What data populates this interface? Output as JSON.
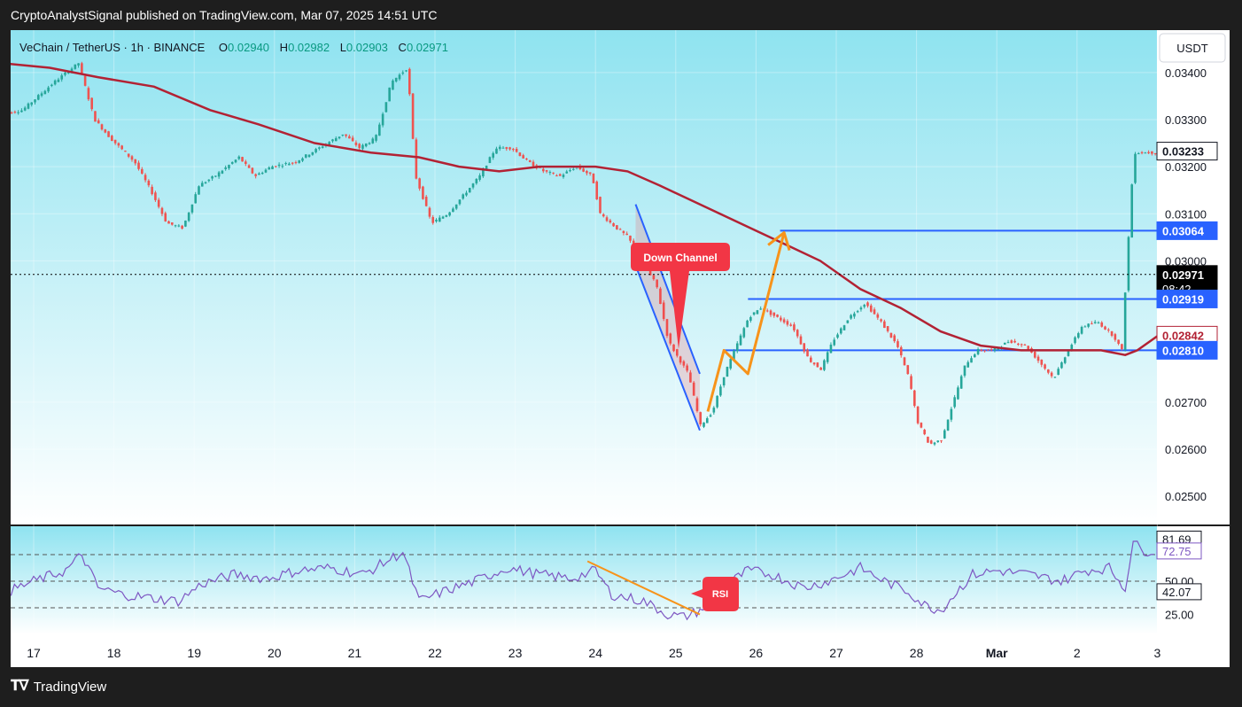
{
  "header": {
    "published": "CryptoAnalystSignal published on TradingView.com, Mar 07, 2025 14:51 UTC"
  },
  "footer": {
    "brand": "TradingView"
  },
  "legend": {
    "symbol": "VeChain / TetherUS · 1h · BINANCE",
    "o_label": "O",
    "o_value": "0.02940",
    "h_label": "H",
    "h_value": "0.02982",
    "l_label": "L",
    "l_value": "0.02903",
    "c_label": "C",
    "c_value": "0.02971"
  },
  "currency_button": "USDT",
  "annotations": {
    "down_channel": "Down Channel",
    "rsi": "RSI"
  },
  "colors": {
    "up": "#26a69a",
    "down": "#ef5350",
    "ma": "#b22234",
    "level": "#2962ff",
    "rsi_line": "#7e57c2",
    "arrow": "#f7931a",
    "bg_top": "#8fe3f0"
  },
  "chart_data": {
    "type": "candlestick",
    "x_tick_labels": [
      "17",
      "18",
      "19",
      "20",
      "21",
      "22",
      "23",
      "24",
      "25",
      "26",
      "27",
      "28",
      "Mar",
      "2",
      "3"
    ],
    "price_axis": {
      "ticks": [
        "0.03400",
        "0.03300",
        "0.03200",
        "0.03100",
        "0.03000",
        "0.02700",
        "0.02600",
        "0.02500"
      ],
      "ylim": [
        0.0244,
        0.0349
      ]
    },
    "price_tags": [
      {
        "value": "0.03233",
        "style": "outline"
      },
      {
        "value": "0.03064",
        "style": "blue"
      },
      {
        "value": "0.02971",
        "style": "black",
        "countdown": "08:42"
      },
      {
        "value": "0.02919",
        "style": "blue"
      },
      {
        "value": "0.02842",
        "style": "red-outline"
      },
      {
        "value": "0.02810",
        "style": "blue"
      }
    ],
    "horizontal_levels": [
      {
        "price": 0.03064,
        "from_day": 26.3
      },
      {
        "price": 0.02919,
        "from_day": 25.9
      },
      {
        "price": 0.0281,
        "from_day": 25.6
      }
    ],
    "current_price": 0.02971,
    "price_path": [
      [
        16.6,
        0.0331
      ],
      [
        16.9,
        0.0332
      ],
      [
        17.3,
        0.0338
      ],
      [
        17.6,
        0.0342
      ],
      [
        17.8,
        0.033
      ],
      [
        18.0,
        0.0326
      ],
      [
        18.3,
        0.0321
      ],
      [
        18.5,
        0.0315
      ],
      [
        18.7,
        0.0308
      ],
      [
        18.9,
        0.0307
      ],
      [
        19.1,
        0.0316
      ],
      [
        19.3,
        0.0318
      ],
      [
        19.6,
        0.0322
      ],
      [
        19.8,
        0.0318
      ],
      [
        20.0,
        0.032
      ],
      [
        20.3,
        0.0321
      ],
      [
        20.6,
        0.0324
      ],
      [
        20.9,
        0.0327
      ],
      [
        21.1,
        0.0324
      ],
      [
        21.3,
        0.0326
      ],
      [
        21.5,
        0.0338
      ],
      [
        21.7,
        0.0341
      ],
      [
        21.8,
        0.0318
      ],
      [
        22.0,
        0.0308
      ],
      [
        22.2,
        0.031
      ],
      [
        22.4,
        0.0314
      ],
      [
        22.6,
        0.0318
      ],
      [
        22.8,
        0.0324
      ],
      [
        23.0,
        0.0324
      ],
      [
        23.2,
        0.0321
      ],
      [
        23.4,
        0.0319
      ],
      [
        23.6,
        0.0318
      ],
      [
        23.8,
        0.032
      ],
      [
        24.0,
        0.0318
      ],
      [
        24.1,
        0.031
      ],
      [
        24.3,
        0.0307
      ],
      [
        24.45,
        0.0305
      ],
      [
        24.6,
        0.03
      ],
      [
        24.8,
        0.0295
      ],
      [
        24.95,
        0.0283
      ],
      [
        25.05,
        0.028
      ],
      [
        25.2,
        0.0276
      ],
      [
        25.35,
        0.0265
      ],
      [
        25.5,
        0.0268
      ],
      [
        25.65,
        0.0276
      ],
      [
        25.8,
        0.0282
      ],
      [
        25.95,
        0.0288
      ],
      [
        26.1,
        0.029
      ],
      [
        26.3,
        0.0288
      ],
      [
        26.5,
        0.0286
      ],
      [
        26.7,
        0.0279
      ],
      [
        26.85,
        0.0277
      ],
      [
        27.0,
        0.0283
      ],
      [
        27.2,
        0.0288
      ],
      [
        27.4,
        0.0291
      ],
      [
        27.6,
        0.0287
      ],
      [
        27.8,
        0.0282
      ],
      [
        27.95,
        0.0275
      ],
      [
        28.05,
        0.0266
      ],
      [
        28.2,
        0.0261
      ],
      [
        28.35,
        0.0262
      ],
      [
        28.5,
        0.027
      ],
      [
        28.65,
        0.0278
      ],
      [
        28.8,
        0.0281
      ],
      [
        29.0,
        0.0281
      ],
      [
        29.2,
        0.0283
      ],
      [
        29.4,
        0.0282
      ],
      [
        29.6,
        0.0278
      ],
      [
        29.75,
        0.0275
      ],
      [
        29.9,
        0.028
      ],
      [
        30.1,
        0.0286
      ],
      [
        30.3,
        0.0287
      ],
      [
        30.5,
        0.0284
      ],
      [
        30.6,
        0.0281
      ],
      [
        30.65,
        0.0296
      ],
      [
        30.75,
        0.0323
      ],
      [
        30.9,
        0.0323
      ],
      [
        31.0,
        0.0323
      ]
    ],
    "ma_path": [
      [
        16.6,
        0.0342
      ],
      [
        17.2,
        0.0341
      ],
      [
        17.8,
        0.0339
      ],
      [
        18.5,
        0.0337
      ],
      [
        19.2,
        0.0332
      ],
      [
        19.8,
        0.0329
      ],
      [
        20.5,
        0.0325
      ],
      [
        21.2,
        0.0323
      ],
      [
        21.8,
        0.0322
      ],
      [
        22.3,
        0.032
      ],
      [
        22.8,
        0.0319
      ],
      [
        23.3,
        0.032
      ],
      [
        23.8,
        0.032
      ],
      [
        24.0,
        0.032
      ],
      [
        24.4,
        0.0319
      ],
      [
        24.8,
        0.0316
      ],
      [
        25.3,
        0.0312
      ],
      [
        25.8,
        0.0308
      ],
      [
        26.3,
        0.0304
      ],
      [
        26.8,
        0.03
      ],
      [
        27.3,
        0.0294
      ],
      [
        27.8,
        0.029
      ],
      [
        28.3,
        0.0285
      ],
      [
        28.8,
        0.0282
      ],
      [
        29.3,
        0.0281
      ],
      [
        29.8,
        0.0281
      ],
      [
        30.3,
        0.0281
      ],
      [
        30.6,
        0.028
      ],
      [
        30.75,
        0.0281
      ],
      [
        31.0,
        0.0284
      ]
    ],
    "rsi": {
      "ticks": [
        "50.00",
        "25.00"
      ],
      "tags": [
        {
          "value": "81.69",
          "style": "outline"
        },
        {
          "value": "72.75",
          "style": "purple-outline"
        },
        {
          "value": "42.07",
          "style": "outline"
        }
      ],
      "levels": [
        70,
        50,
        30
      ],
      "ylim": [
        10,
        90
      ],
      "path": [
        [
          16.6,
          40
        ],
        [
          17.0,
          50
        ],
        [
          17.4,
          58
        ],
        [
          17.6,
          70
        ],
        [
          17.8,
          45
        ],
        [
          18.1,
          40
        ],
        [
          18.5,
          37
        ],
        [
          18.8,
          35
        ],
        [
          19.1,
          48
        ],
        [
          19.5,
          55
        ],
        [
          19.9,
          52
        ],
        [
          20.3,
          58
        ],
        [
          20.7,
          60
        ],
        [
          21.1,
          55
        ],
        [
          21.4,
          65
        ],
        [
          21.6,
          72
        ],
        [
          21.8,
          35
        ],
        [
          22.1,
          42
        ],
        [
          22.5,
          50
        ],
        [
          22.9,
          60
        ],
        [
          23.3,
          55
        ],
        [
          23.7,
          52
        ],
        [
          24.0,
          58
        ],
        [
          24.2,
          40
        ],
        [
          24.6,
          35
        ],
        [
          24.9,
          25
        ],
        [
          25.1,
          23
        ],
        [
          25.3,
          28
        ],
        [
          25.5,
          38
        ],
        [
          25.7,
          50
        ],
        [
          25.9,
          58
        ],
        [
          26.2,
          55
        ],
        [
          26.6,
          45
        ],
        [
          26.9,
          50
        ],
        [
          27.3,
          60
        ],
        [
          27.6,
          50
        ],
        [
          27.9,
          42
        ],
        [
          28.1,
          32
        ],
        [
          28.3,
          28
        ],
        [
          28.5,
          42
        ],
        [
          28.7,
          55
        ],
        [
          29.0,
          58
        ],
        [
          29.4,
          55
        ],
        [
          29.8,
          50
        ],
        [
          30.1,
          58
        ],
        [
          30.4,
          60
        ],
        [
          30.6,
          45
        ],
        [
          30.7,
          80
        ],
        [
          30.8,
          73
        ],
        [
          31.0,
          73
        ]
      ]
    },
    "drawings": {
      "down_channel": {
        "top": [
          [
            24.5,
            0.0312
          ],
          [
            25.3,
            0.0276
          ]
        ],
        "bottom": [
          [
            24.5,
            0.0299
          ],
          [
            25.3,
            0.0264
          ]
        ]
      },
      "projection_arrow": [
        [
          25.4,
          0.0268
        ],
        [
          25.6,
          0.0281
        ],
        [
          25.9,
          0.0276
        ],
        [
          26.35,
          0.0306
        ]
      ],
      "rsi_trendline": [
        [
          23.9,
          65
        ],
        [
          25.3,
          25
        ]
      ]
    }
  }
}
